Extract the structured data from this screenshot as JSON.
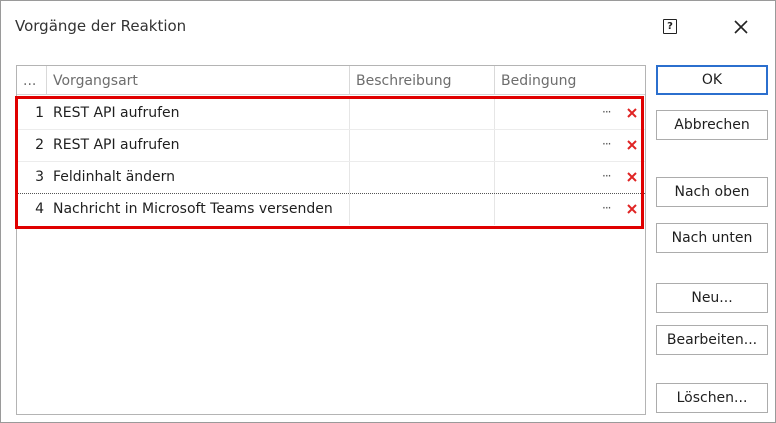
{
  "window": {
    "title": "Vorgänge der Reaktion",
    "help_glyph": "?",
    "close_glyph": "✕"
  },
  "grid": {
    "columns": [
      "...",
      "Vorgangsart",
      "Beschreibung",
      "Bedingung"
    ],
    "rows": [
      {
        "num": "1",
        "type": "REST API aufrufen",
        "description": "",
        "condition": ""
      },
      {
        "num": "2",
        "type": "REST API aufrufen",
        "description": "",
        "condition": ""
      },
      {
        "num": "3",
        "type": "Feldinhalt ändern",
        "description": "",
        "condition": ""
      },
      {
        "num": "4",
        "type": "Nachricht in Microsoft Teams versenden",
        "description": "",
        "condition": ""
      }
    ],
    "ellipsis_glyph": "···",
    "highlight_color": "#e00000",
    "delete_color": "#e02424"
  },
  "buttons": {
    "ok": "OK",
    "cancel": "Abbrechen",
    "move_up": "Nach oben",
    "move_down": "Nach unten",
    "new": "Neu...",
    "edit": "Bearbeiten...",
    "delete": "Löschen..."
  },
  "colors": {
    "default_button_border": "#2b6fce"
  }
}
